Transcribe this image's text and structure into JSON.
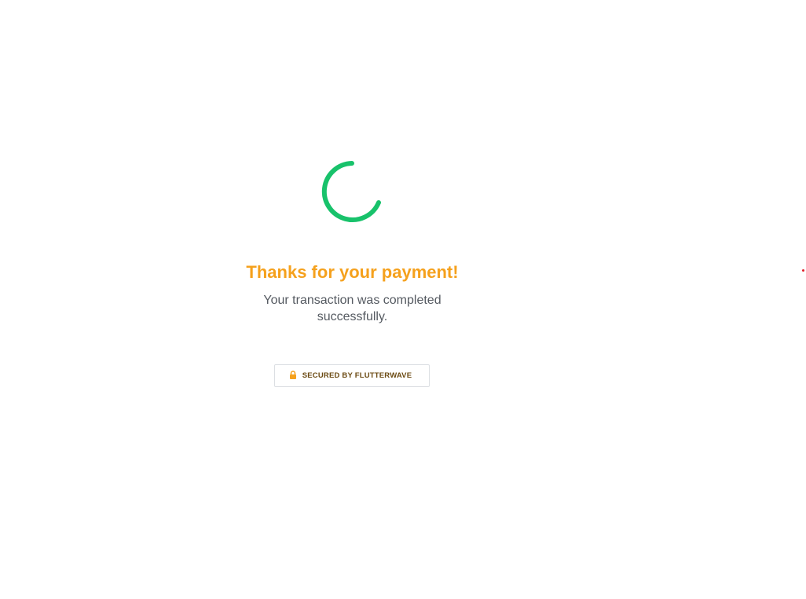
{
  "status": {
    "spinner_icon": "loading-spinner-icon",
    "spinner_color": "#18c26b"
  },
  "confirmation": {
    "title": "Thanks for your payment!",
    "message": "Your transaction was completed successfully.",
    "title_color": "#f5a11d"
  },
  "security_badge": {
    "icon": "lock-icon",
    "label": "SECURED BY FLUTTERWAVE",
    "icon_color": "#f5a11d"
  }
}
